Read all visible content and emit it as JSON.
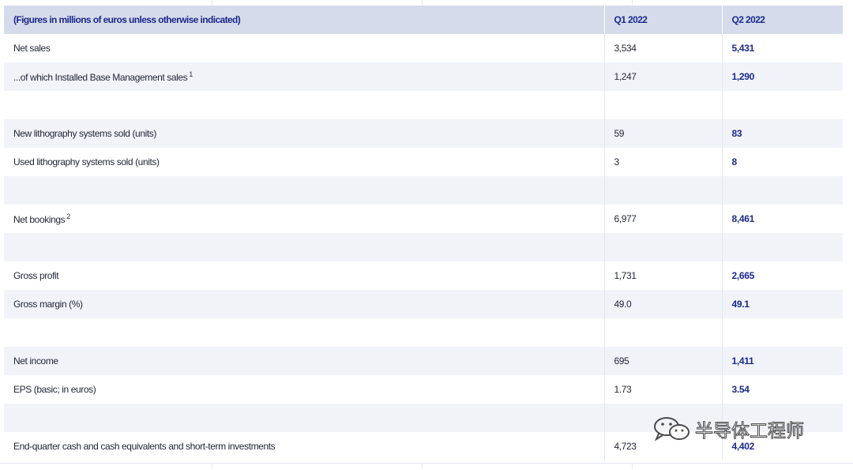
{
  "table": {
    "header": {
      "label": "(Figures in millions of euros unless otherwise indicated)",
      "q1": "Q1 2022",
      "q2": "Q2 2022"
    },
    "rows": [
      {
        "label": "Net sales",
        "sup": "",
        "q1": "3,534",
        "q2": "5,431"
      },
      {
        "label": "...of which Installed Base Management sales",
        "sup": "1",
        "q1": "1,247",
        "q2": "1,290"
      },
      {
        "label": "",
        "sup": "",
        "q1": "",
        "q2": ""
      },
      {
        "label": "New lithography systems sold (units)",
        "sup": "",
        "q1": "59",
        "q2": "83"
      },
      {
        "label": "Used lithography systems sold (units)",
        "sup": "",
        "q1": "3",
        "q2": "8"
      },
      {
        "label": "",
        "sup": "",
        "q1": "",
        "q2": ""
      },
      {
        "label": "Net bookings",
        "sup": "2",
        "q1": "6,977",
        "q2": "8,461"
      },
      {
        "label": "",
        "sup": "",
        "q1": "",
        "q2": ""
      },
      {
        "label": "Gross profit",
        "sup": "",
        "q1": "1,731",
        "q2": "2,665"
      },
      {
        "label": "Gross margin (%)",
        "sup": "",
        "q1": "49.0",
        "q2": "49.1"
      },
      {
        "label": "",
        "sup": "",
        "q1": "",
        "q2": ""
      },
      {
        "label": "Net income",
        "sup": "",
        "q1": "695",
        "q2": "1,411"
      },
      {
        "label": "EPS (basic; in euros)",
        "sup": "",
        "q1": "1.73",
        "q2": "3.54"
      },
      {
        "label": "",
        "sup": "",
        "q1": "",
        "q2": ""
      },
      {
        "label": "End-quarter cash and cash equivalents and short-term investments",
        "sup": "",
        "q1": "4,723",
        "q2": "4,402"
      }
    ]
  },
  "watermark": {
    "text": "半导体工程师",
    "icon": "wechat-icon"
  },
  "colors": {
    "header_bg": "#d6dbeb",
    "header_text": "#1a2a8c",
    "row_alt_bg": "#f1f3f9",
    "q2_value": "#1a2a8c"
  }
}
